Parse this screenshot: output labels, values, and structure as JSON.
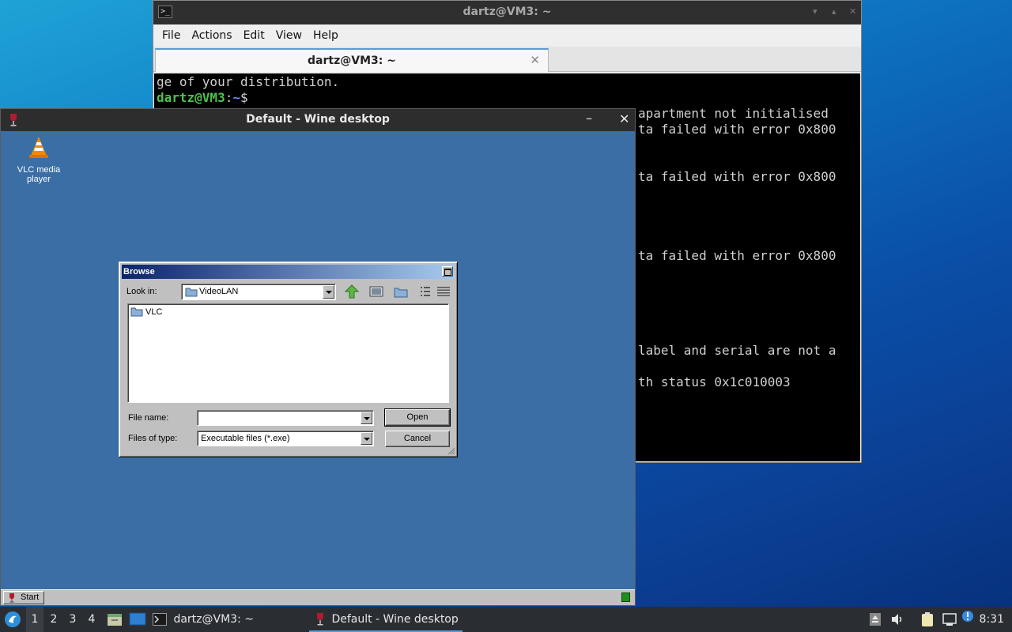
{
  "terminal": {
    "title": "dartz@VM3: ~",
    "menu": [
      "File",
      "Actions",
      "Edit",
      "View",
      "Help"
    ],
    "tab_label": "dartz@VM3: ~",
    "lines": {
      "distribution": "ge of your distribution.",
      "prompt_user": "dartz@VM3",
      "prompt_sep": ":",
      "prompt_path": "~",
      "prompt_symbol": "$"
    },
    "right_lines": [
      "apartment not initialised",
      "ta failed with error 0x800",
      "ta failed with error 0x800",
      "ta failed with error 0x800",
      "label and serial are not a",
      "th status 0x1c010003"
    ]
  },
  "wine": {
    "title": "Default - Wine desktop",
    "desktop_icon_label": "VLC media player",
    "start_label": "Start",
    "minimize_glyph": "–",
    "close_glyph": "✕"
  },
  "browse": {
    "title": "Browse",
    "look_in_label": "Look in:",
    "look_in_value": "VideoLAN",
    "files": [
      "VLC"
    ],
    "file_name_label": "File name:",
    "file_name_value": "",
    "files_of_type_label": "Files of type:",
    "files_of_type_value": "Executable files (*.exe)",
    "open_label": "Open",
    "cancel_label": "Cancel"
  },
  "panel": {
    "desktops": [
      "1",
      "2",
      "3",
      "4"
    ],
    "tasks": [
      "dartz@VM3: ~",
      "Default - Wine desktop"
    ],
    "clock": "8:31"
  },
  "colors": {
    "wine_desktop": "#3a6ea5",
    "terminal_bg": "#000000",
    "prompt_user": "#4ec04e",
    "prompt_path": "#6a8cff",
    "panel_bg": "#2a2e33",
    "accent": "#5b9bd5"
  }
}
